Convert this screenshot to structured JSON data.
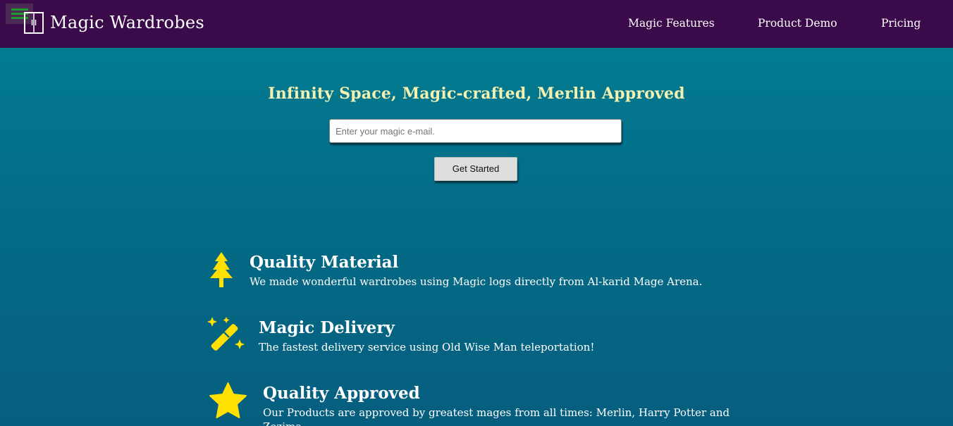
{
  "navbar": {
    "brand": "Magic Wardrobes",
    "links": {
      "features": "Magic Features",
      "demo": "Product Demo",
      "pricing": "Pricing"
    }
  },
  "hero": {
    "title": "Infinity Space, Magic-crafted, Merlin Approved",
    "email_placeholder": "Enter your magic e-mail.",
    "cta_label": "Get Started"
  },
  "features": [
    {
      "icon": "tree-icon",
      "title": "Quality Material",
      "description": "We made wonderful wardrobes using Magic logs directly from Al-karid Mage Arena."
    },
    {
      "icon": "magic-wand-icon",
      "title": "Magic Delivery",
      "description": "The fastest delivery service using Old Wise Man teleportation!"
    },
    {
      "icon": "star-icon",
      "title": "Quality Approved",
      "description": "Our Products are approved by greatest mages from all times: Merlin, Harry Potter and Zezima"
    }
  ],
  "colors": {
    "navbar_bg": "#3a0a4a",
    "hero_title": "#f3f0b0",
    "icon_yellow": "#ffe000",
    "hamburger_green": "#1f9a2a"
  }
}
